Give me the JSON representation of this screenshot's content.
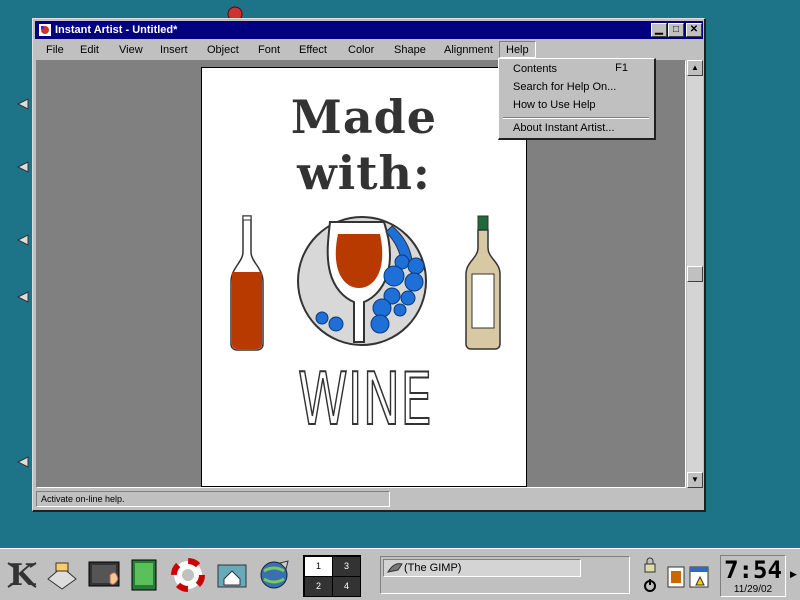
{
  "window": {
    "title": "Instant Artist - Untitled*",
    "minimize_glyph": "▁",
    "maximize_glyph": "□",
    "close_glyph": "✕"
  },
  "menubar": {
    "items": [
      {
        "label": "File",
        "underline": "F"
      },
      {
        "label": "Edit",
        "underline": "E"
      },
      {
        "label": "View",
        "underline": "V"
      },
      {
        "label": "Insert",
        "underline": "I"
      },
      {
        "label": "Object",
        "underline": "O"
      },
      {
        "label": "Font",
        "underline": "n"
      },
      {
        "label": "Effect",
        "underline": "c"
      },
      {
        "label": "Color",
        "underline": "C"
      },
      {
        "label": "Shape",
        "underline": "S"
      },
      {
        "label": "Alignment",
        "underline": "A"
      },
      {
        "label": "Help",
        "underline": "H"
      }
    ],
    "active": "Help"
  },
  "help_menu": {
    "items": [
      {
        "label": "Contents",
        "shortcut": "F1"
      },
      {
        "label": "Search for Help On..."
      },
      {
        "label": "How to Use Help"
      },
      {
        "label": "About Instant Artist..."
      }
    ]
  },
  "document": {
    "line1": "Made",
    "line2": "with:",
    "word": "WINE"
  },
  "status_bar": {
    "text": "Activate on-line help."
  },
  "scrollbar": {
    "up_glyph": "▲",
    "down_glyph": "▼"
  },
  "taskbar": {
    "pager": [
      "1",
      "3",
      "2",
      "4"
    ],
    "active_task": "(The GIMP)",
    "clock_time": "7:54",
    "clock_date": "11/29/02"
  },
  "colors": {
    "desktop": "#1d7489",
    "titlebar": "#000080",
    "wine_red": "#b83a00",
    "grape_blue": "#1f6fd8"
  }
}
